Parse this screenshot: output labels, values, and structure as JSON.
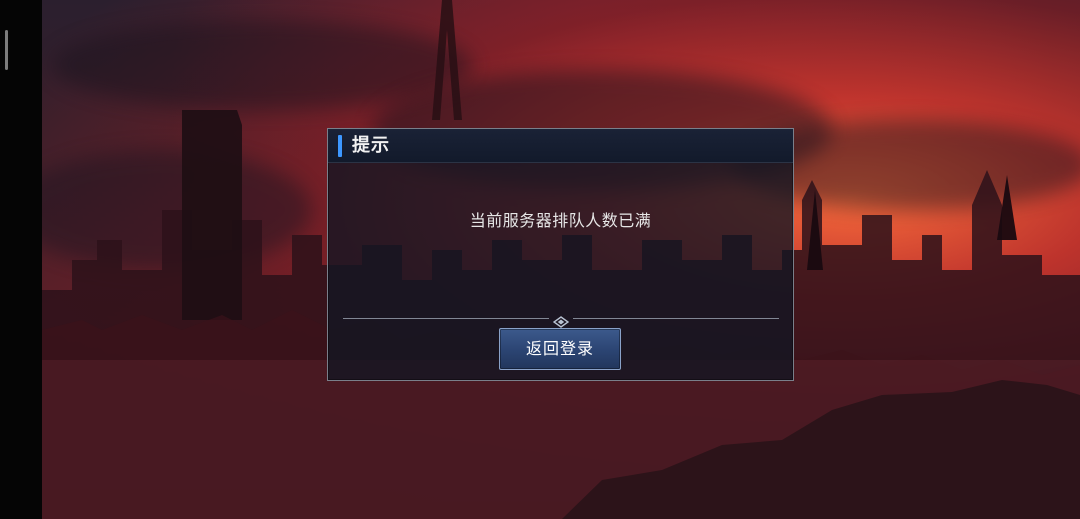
{
  "screen": {
    "left_handle": "status-bar-handle",
    "background": {
      "scene": "ruined-city-red-sunset",
      "accent_colors": {
        "sky_red": "#d8373a",
        "sky_orange": "#ff6e3c",
        "silhouette": "#140b10"
      }
    }
  },
  "dialog": {
    "title": "提示",
    "message": "当前服务器排队人数已满",
    "divider_icon": "diamond-ornament-icon",
    "return_button_label": "返回登录",
    "colors": {
      "accent": "#3d98ff",
      "panel": "#121a2b",
      "button": "#2b4472",
      "border": "#7a7f8a"
    }
  }
}
